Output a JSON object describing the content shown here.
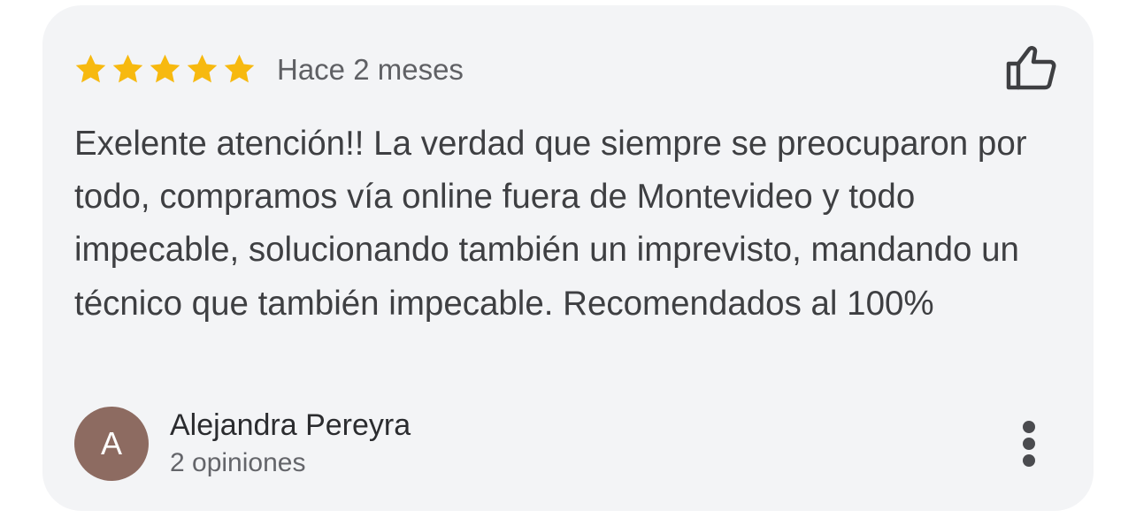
{
  "review": {
    "rating": 5,
    "rating_max": 5,
    "time": "Hace 2 meses",
    "text": "Exelente atención!! La verdad que siempre se preocuparon por todo, compramos vía online fuera de Montevideo y todo impecable, solucionando también un imprevisto, mandando un técnico que también impecable. Recomendados al 100%",
    "like_icon": "thumbs-up-outline-icon",
    "more_icon": "more-vertical-icon"
  },
  "author": {
    "initial": "A",
    "name": "Alejandra Pereyra",
    "reviews": "2 opiniones",
    "avatar_color": "#8d6b61"
  },
  "colors": {
    "star": "#f7b90f",
    "card": "#f3f4f6"
  }
}
